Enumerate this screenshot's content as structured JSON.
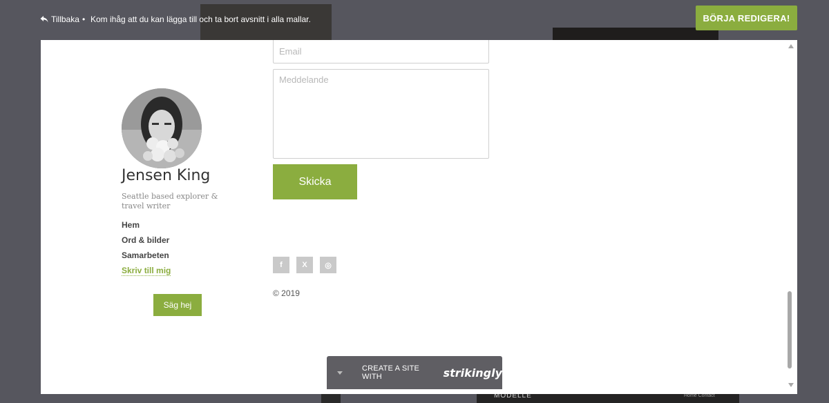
{
  "background": {
    "label_left": "MODELLE",
    "label_right": "Home  Contact"
  },
  "topbar": {
    "back_label": "Tillbaka",
    "separator": "•",
    "reminder": "Kom ihåg att du kan lägga till och ta bort avsnitt i alla mallar.",
    "start_button": "BÖRJA REDIGERA!"
  },
  "profile": {
    "name": "Jensen King",
    "tagline": "Seattle based explorer & travel writer",
    "nav": [
      {
        "label": "Hem"
      },
      {
        "label": "Ord & bilder"
      },
      {
        "label": "Samarbeten"
      },
      {
        "label": "Skriv till mig"
      }
    ],
    "say_hi": "Säg hej"
  },
  "form": {
    "email_placeholder": "Email",
    "message_placeholder": "Meddelande",
    "send_label": "Skicka"
  },
  "socials": [
    {
      "icon": "facebook-icon",
      "glyph": "f"
    },
    {
      "icon": "x-icon",
      "glyph": "X"
    },
    {
      "icon": "instagram-icon",
      "glyph": "◎"
    }
  ],
  "copyright": "© 2019",
  "banner": {
    "text": "CREATE A SITE WITH",
    "brand": "strikingly"
  },
  "colors": {
    "accent": "#8bad3f",
    "overlay": "#56565e"
  }
}
